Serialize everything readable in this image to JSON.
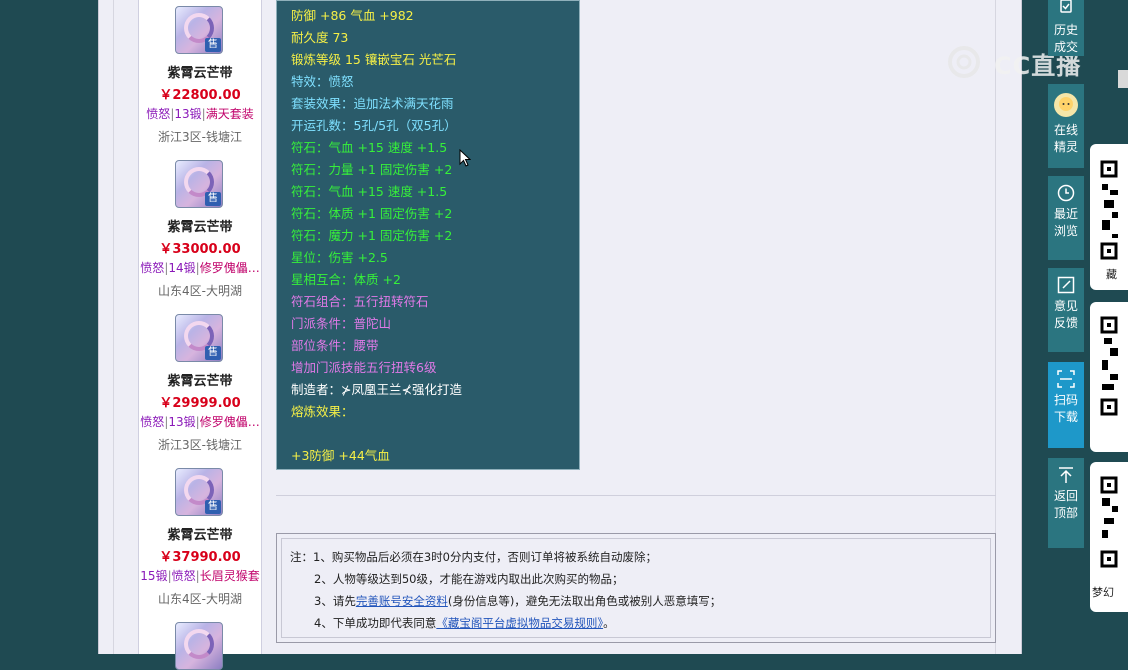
{
  "listings": [
    {
      "name": "紫霄云芒带",
      "price": "￥22800.00",
      "tags": [
        {
          "text": "愤怒",
          "cls": "t1"
        },
        {
          "text": "13锻",
          "cls": "t1"
        },
        {
          "text": "满天套装",
          "cls": "t2"
        }
      ],
      "server": "浙江3区-钱塘江",
      "badge": "售"
    },
    {
      "name": "紫霄云芒带",
      "price": "￥33000.00",
      "tags": [
        {
          "text": "愤怒",
          "cls": "t1"
        },
        {
          "text": "14锻",
          "cls": "t1"
        },
        {
          "text": "修罗傀儡…",
          "cls": "t2"
        }
      ],
      "server": "山东4区-大明湖",
      "badge": "售"
    },
    {
      "name": "紫霄云芒带",
      "price": "￥29999.00",
      "tags": [
        {
          "text": "愤怒",
          "cls": "t1"
        },
        {
          "text": "13锻",
          "cls": "t1"
        },
        {
          "text": "修罗傀儡…",
          "cls": "t2"
        }
      ],
      "server": "浙江3区-钱塘江",
      "badge": "售"
    },
    {
      "name": "紫霄云芒带",
      "price": "￥37990.00",
      "tags": [
        {
          "text": "15锻",
          "cls": "t1"
        },
        {
          "text": "愤怒",
          "cls": "t1"
        },
        {
          "text": "长眉灵猴套",
          "cls": "t2"
        }
      ],
      "server": "山东4区-大明湖",
      "badge": "售"
    }
  ],
  "detail": {
    "lines": [
      {
        "text": "防御 +86 气血 +982",
        "cls": "y"
      },
      {
        "text": "耐久度 73",
        "cls": "y"
      },
      {
        "text": "锻炼等级 15 镶嵌宝石 光芒石",
        "cls": "y"
      },
      {
        "text": "特效：愤怒",
        "cls": "c"
      },
      {
        "text": "套装效果：追加法术满天花雨",
        "cls": "c"
      },
      {
        "text": "开运孔数：5孔/5孔（双5孔）",
        "cls": "c"
      },
      {
        "text": "符石：气血 +15 速度 +1.5",
        "cls": "g"
      },
      {
        "text": "符石：力量 +1 固定伤害 +2",
        "cls": "g"
      },
      {
        "text": "符石：气血 +15 速度 +1.5",
        "cls": "g"
      },
      {
        "text": "符石：体质 +1 固定伤害 +2",
        "cls": "g"
      },
      {
        "text": "符石：魔力 +1 固定伤害 +2",
        "cls": "g"
      },
      {
        "text": "星位：伤害 +2.5",
        "cls": "g"
      },
      {
        "text": "星相互合：体质 +2",
        "cls": "g"
      },
      {
        "text": "符石组合：五行扭转符石",
        "cls": "p"
      },
      {
        "text": "门派条件：普陀山",
        "cls": "p"
      },
      {
        "text": "部位条件：腰带",
        "cls": "p"
      },
      {
        "text": "增加门派技能五行扭转6级",
        "cls": "p"
      },
      {
        "text": "制造者：⊁凤凰王兰⊀强化打造",
        "cls": "w"
      },
      {
        "text": "熔炼效果：",
        "cls": "y"
      },
      {
        "text": "",
        "cls": "y"
      },
      {
        "text": "+3防御 +44气血",
        "cls": "y"
      }
    ]
  },
  "notes": {
    "l1": "注：1、购买物品后必须在3时0分内支付，否则订单将被系统自动废除；",
    "l2": "2、人物等级达到50级，才能在游戏内取出此次购买的物品；",
    "l3_pre": "3、请先",
    "l3_link": "完善账号安全资料",
    "l3_post": "(身份信息等)，避免无法取出角色或被别人恶意填写；",
    "l4_pre": "4、下单成功即代表同意",
    "l4_link": "《藏宝阁平台虚拟物品交易规则》",
    "l4_post": "。"
  },
  "sidebar": {
    "history": "历史成交",
    "online_1": "在线",
    "online_2": "精灵",
    "recent_1": "最近",
    "recent_2": "浏览",
    "feedback_1": "意见",
    "feedback_2": "反馈",
    "scan_1": "扫码",
    "scan_2": "下载",
    "top_1": "返回",
    "top_2": "顶部"
  },
  "qr": {
    "label_1": "藏",
    "label_3": "梦幻"
  },
  "watermark": {
    "text": "CC直播"
  },
  "colors": {
    "panel": "#2a5b6a",
    "accent": "#1e98c9",
    "price": "#d8001a"
  }
}
